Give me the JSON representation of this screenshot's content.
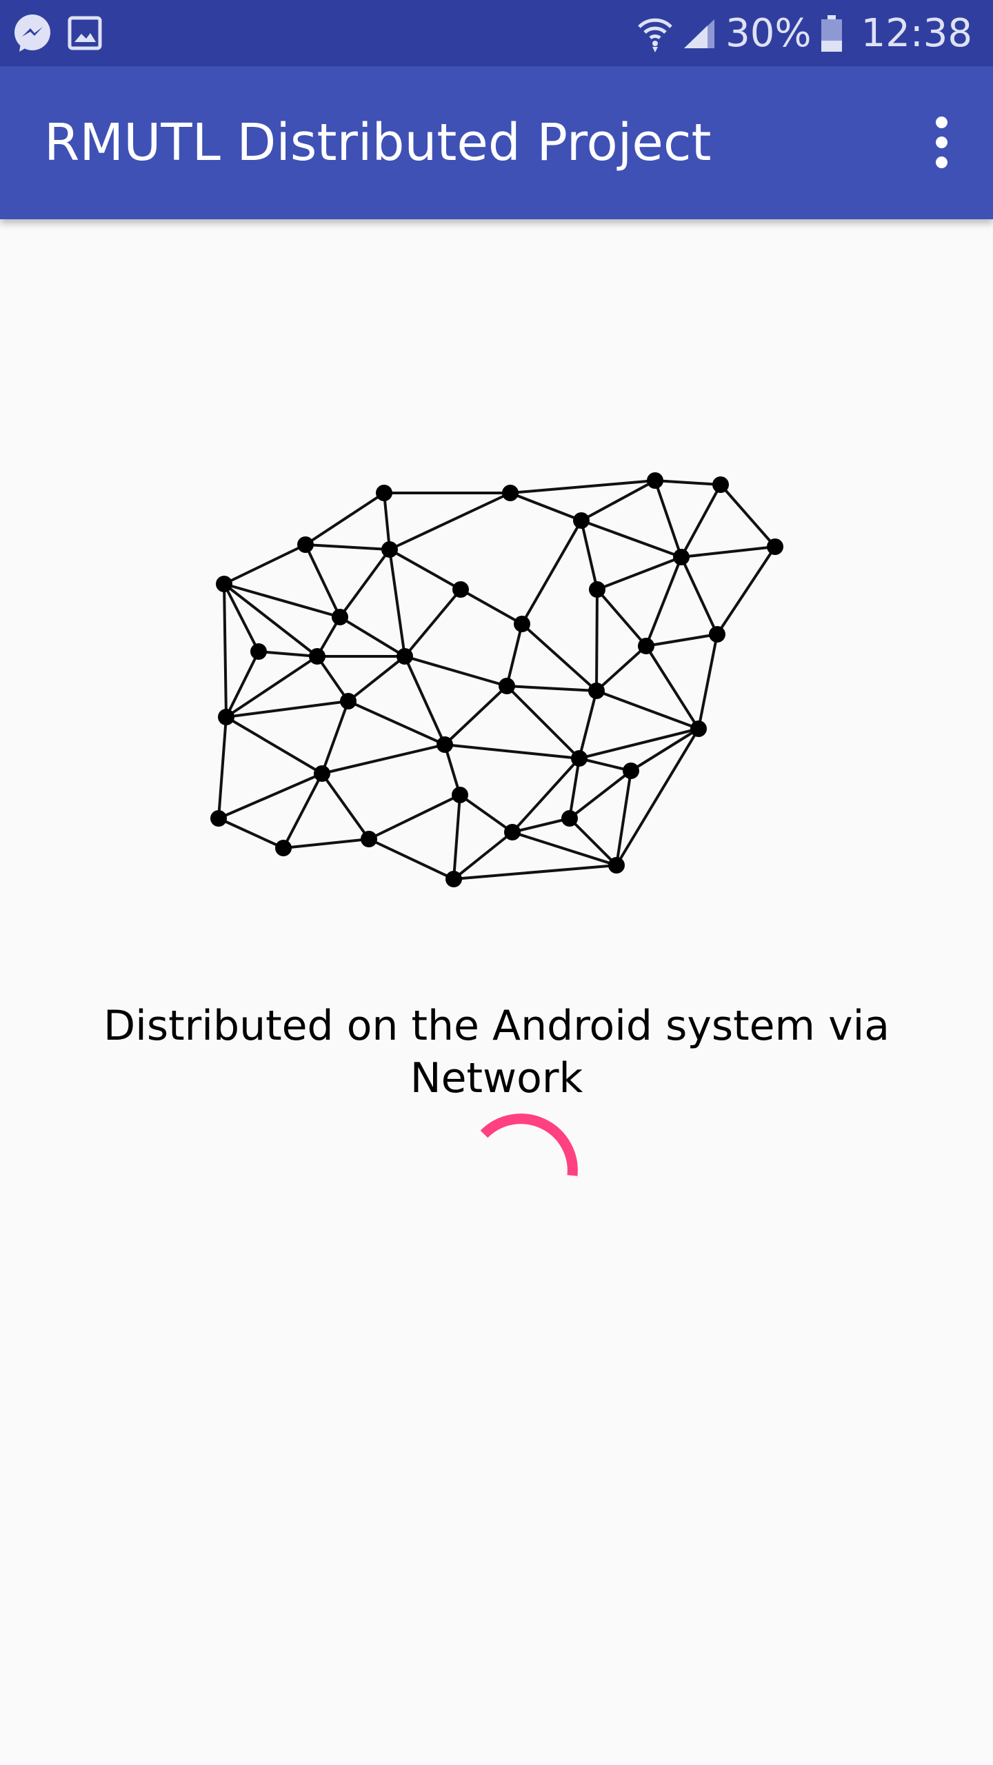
{
  "status_bar": {
    "left_icons": [
      "messenger-icon",
      "gallery-icon"
    ],
    "right_icons": [
      "wifi-icon",
      "signal-icon",
      "battery-icon"
    ],
    "battery_text": "30%",
    "time": "12:38"
  },
  "app_bar": {
    "title": "RMUTL Distributed Project",
    "menu_icon": "overflow-menu-icon"
  },
  "content": {
    "illustration": "network-graph-illustration",
    "caption": "Distributed on the Android system via Network",
    "progress": "indeterminate"
  },
  "colors": {
    "status_bar": "#303f9f",
    "app_bar": "#3f51b5",
    "background": "#fafafa",
    "accent": "#ff4081"
  }
}
